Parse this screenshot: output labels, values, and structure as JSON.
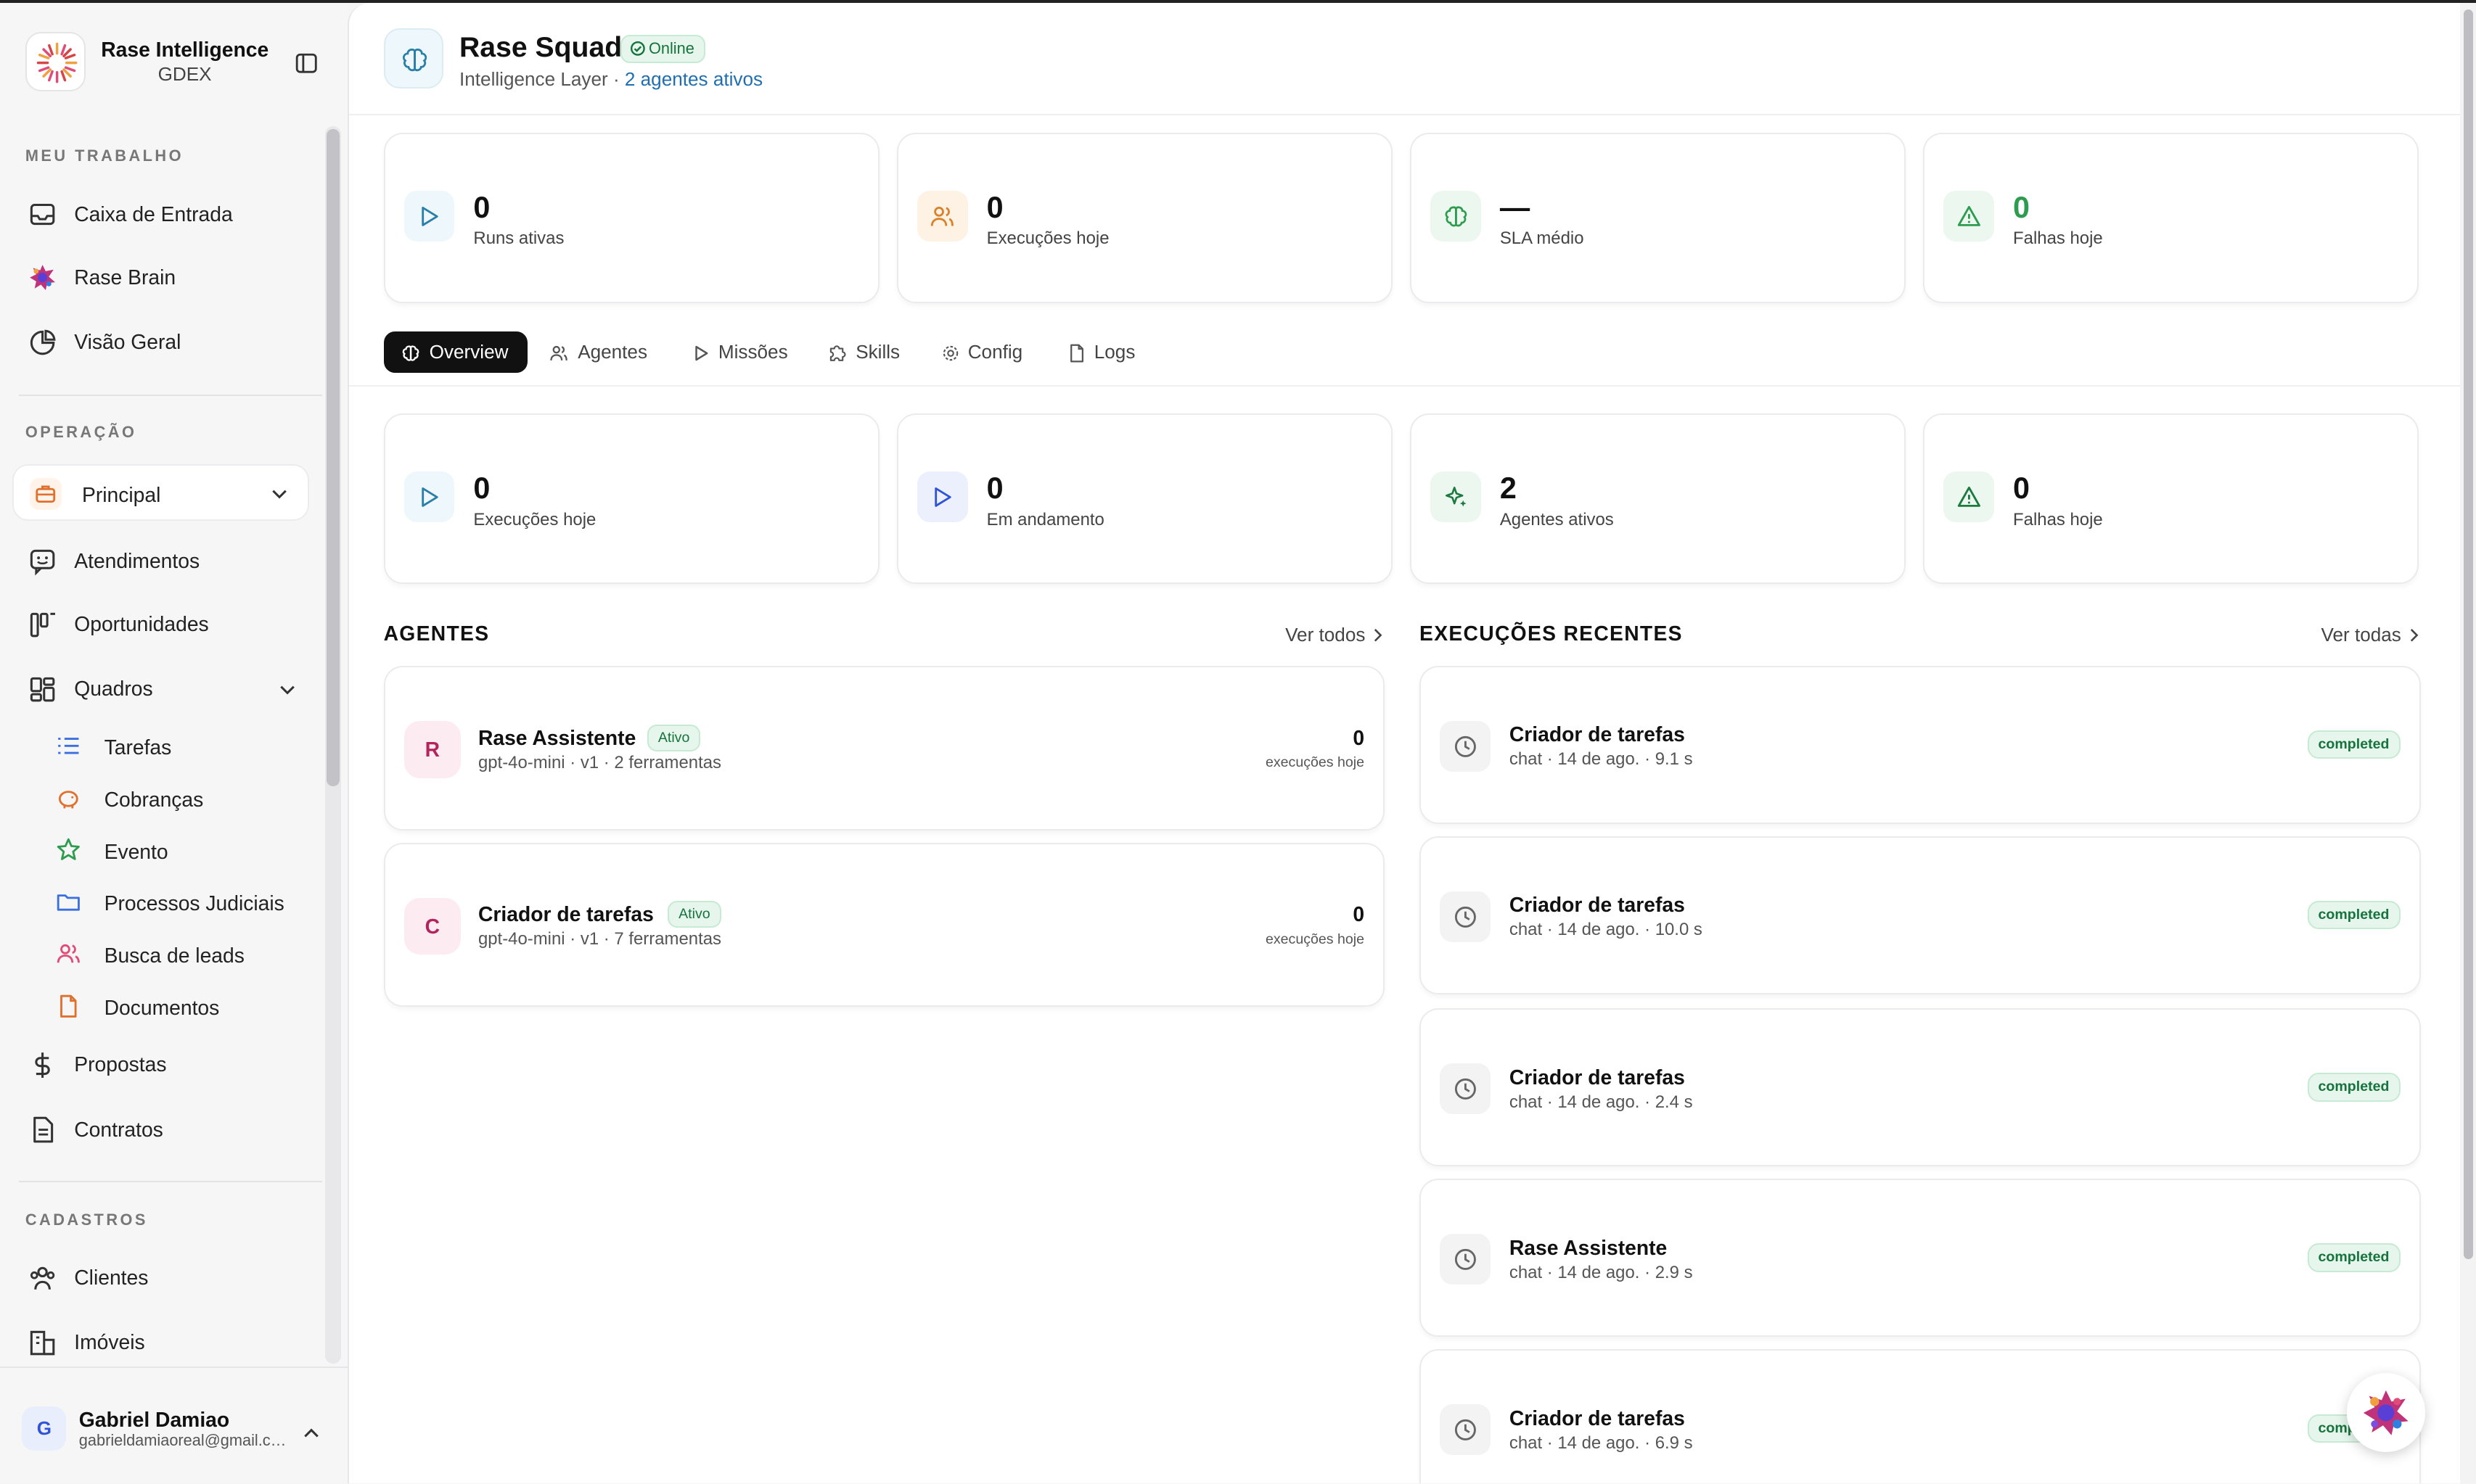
{
  "brand": {
    "name": "Rase Intelligence",
    "workspace": "GDEX"
  },
  "sidebar": {
    "sections": {
      "my_work": "MEU TRABALHO",
      "operation": "OPERAÇÃO",
      "records": "CADASTROS"
    },
    "my_work": [
      {
        "label": "Caixa de Entrada",
        "icon": "inbox-icon"
      },
      {
        "label": "Rase Brain",
        "icon": "rase-brain-logo-icon"
      },
      {
        "label": "Visão Geral",
        "icon": "pie-chart-icon"
      }
    ],
    "workspace_select": {
      "label": "Principal",
      "icon": "briefcase-icon"
    },
    "operation": [
      {
        "label": "Atendimentos",
        "icon": "chat-smile-icon"
      },
      {
        "label": "Oportunidades",
        "icon": "kanban-icon"
      },
      {
        "label": "Quadros",
        "icon": "boards-icon"
      }
    ],
    "boards": [
      {
        "label": "Tarefas",
        "icon": "list-icon",
        "color": "#3b6fe0"
      },
      {
        "label": "Cobranças",
        "icon": "piggy-bank-icon",
        "color": "#e0702c"
      },
      {
        "label": "Evento",
        "icon": "star-icon",
        "color": "#2e9c4f"
      },
      {
        "label": "Processos Judiciais",
        "icon": "folder-icon",
        "color": "#3b6fe0"
      },
      {
        "label": "Busca de leads",
        "icon": "users-icon",
        "color": "#e04b78"
      },
      {
        "label": "Documentos",
        "icon": "file-icon",
        "color": "#e0702c"
      }
    ],
    "operation_more": [
      {
        "label": "Propostas",
        "icon": "dollar-icon"
      },
      {
        "label": "Contratos",
        "icon": "document-icon"
      }
    ],
    "records": [
      {
        "label": "Clientes",
        "icon": "users-icon"
      },
      {
        "label": "Imóveis",
        "icon": "building-icon"
      }
    ]
  },
  "user": {
    "initial": "G",
    "name": "Gabriel Damiao",
    "email": "gabrieldamiaoreal@gmail.com"
  },
  "header": {
    "title": "Rase Squad",
    "status": "Online",
    "subtitle": "Intelligence Layer",
    "separator": " · ",
    "active_agents_link": "2 agentes ativos"
  },
  "top_stats": [
    {
      "value": "0",
      "label": "Runs ativas",
      "icon": "play-icon",
      "accent": "#2a7fa8"
    },
    {
      "value": "0",
      "label": "Execuções hoje",
      "icon": "users-icon",
      "accent": "#d9822b"
    },
    {
      "value": "—",
      "label": "SLA médio",
      "icon": "brain-icon",
      "accent": "#2e9c4f"
    },
    {
      "value": "0",
      "label": "Falhas hoje",
      "icon": "alert-triangle-icon",
      "accent": "#2e9c4f"
    }
  ],
  "tabs": [
    {
      "label": "Overview",
      "icon": "brain-icon",
      "active": true
    },
    {
      "label": "Agentes",
      "icon": "users-icon",
      "active": false
    },
    {
      "label": "Missões",
      "icon": "play-icon",
      "active": false
    },
    {
      "label": "Skills",
      "icon": "puzzle-icon",
      "active": false
    },
    {
      "label": "Config",
      "icon": "gear-icon",
      "active": false
    },
    {
      "label": "Logs",
      "icon": "file-icon",
      "active": false
    }
  ],
  "overview_stats": [
    {
      "value": "0",
      "label": "Execuções hoje",
      "icon": "play-icon",
      "accent": "#2a7fa8"
    },
    {
      "value": "0",
      "label": "Em andamento",
      "icon": "play-icon",
      "accent": "#2f54d6"
    },
    {
      "value": "2",
      "label": "Agentes ativos",
      "icon": "sparkles-icon",
      "accent": "#2e9c4f"
    },
    {
      "value": "0",
      "label": "Falhas hoje",
      "icon": "alert-triangle-icon",
      "accent": "#2e9c4f"
    }
  ],
  "agents_section": {
    "title": "AGENTES",
    "see_all": "Ver todos"
  },
  "agents": [
    {
      "initial": "R",
      "name": "Rase Assistente",
      "status": "Ativo",
      "details": "gpt-4o-mini · v1 · 2 ferramentas",
      "count": "0",
      "count_label": "execuções hoje"
    },
    {
      "initial": "C",
      "name": "Criador de tarefas",
      "status": "Ativo",
      "details": "gpt-4o-mini · v1 · 7 ferramentas",
      "count": "0",
      "count_label": "execuções hoje"
    }
  ],
  "executions_section": {
    "title": "EXECUÇÕES RECENTES",
    "see_all": "Ver todas"
  },
  "executions": [
    {
      "title": "Criador de tarefas",
      "details": "chat · 14 de ago. · 9.1 s",
      "status": "completed"
    },
    {
      "title": "Criador de tarefas",
      "details": "chat · 14 de ago. · 10.0 s",
      "status": "completed"
    },
    {
      "title": "Criador de tarefas",
      "details": "chat · 14 de ago. · 2.4 s",
      "status": "completed"
    },
    {
      "title": "Rase Assistente",
      "details": "chat · 14 de ago. · 2.9 s",
      "status": "completed"
    },
    {
      "title": "Criador de tarefas",
      "details": "chat · 14 de ago. · 6.9 s",
      "status": "completed"
    }
  ],
  "fab": {
    "icon": "rase-brain-logo-icon"
  }
}
